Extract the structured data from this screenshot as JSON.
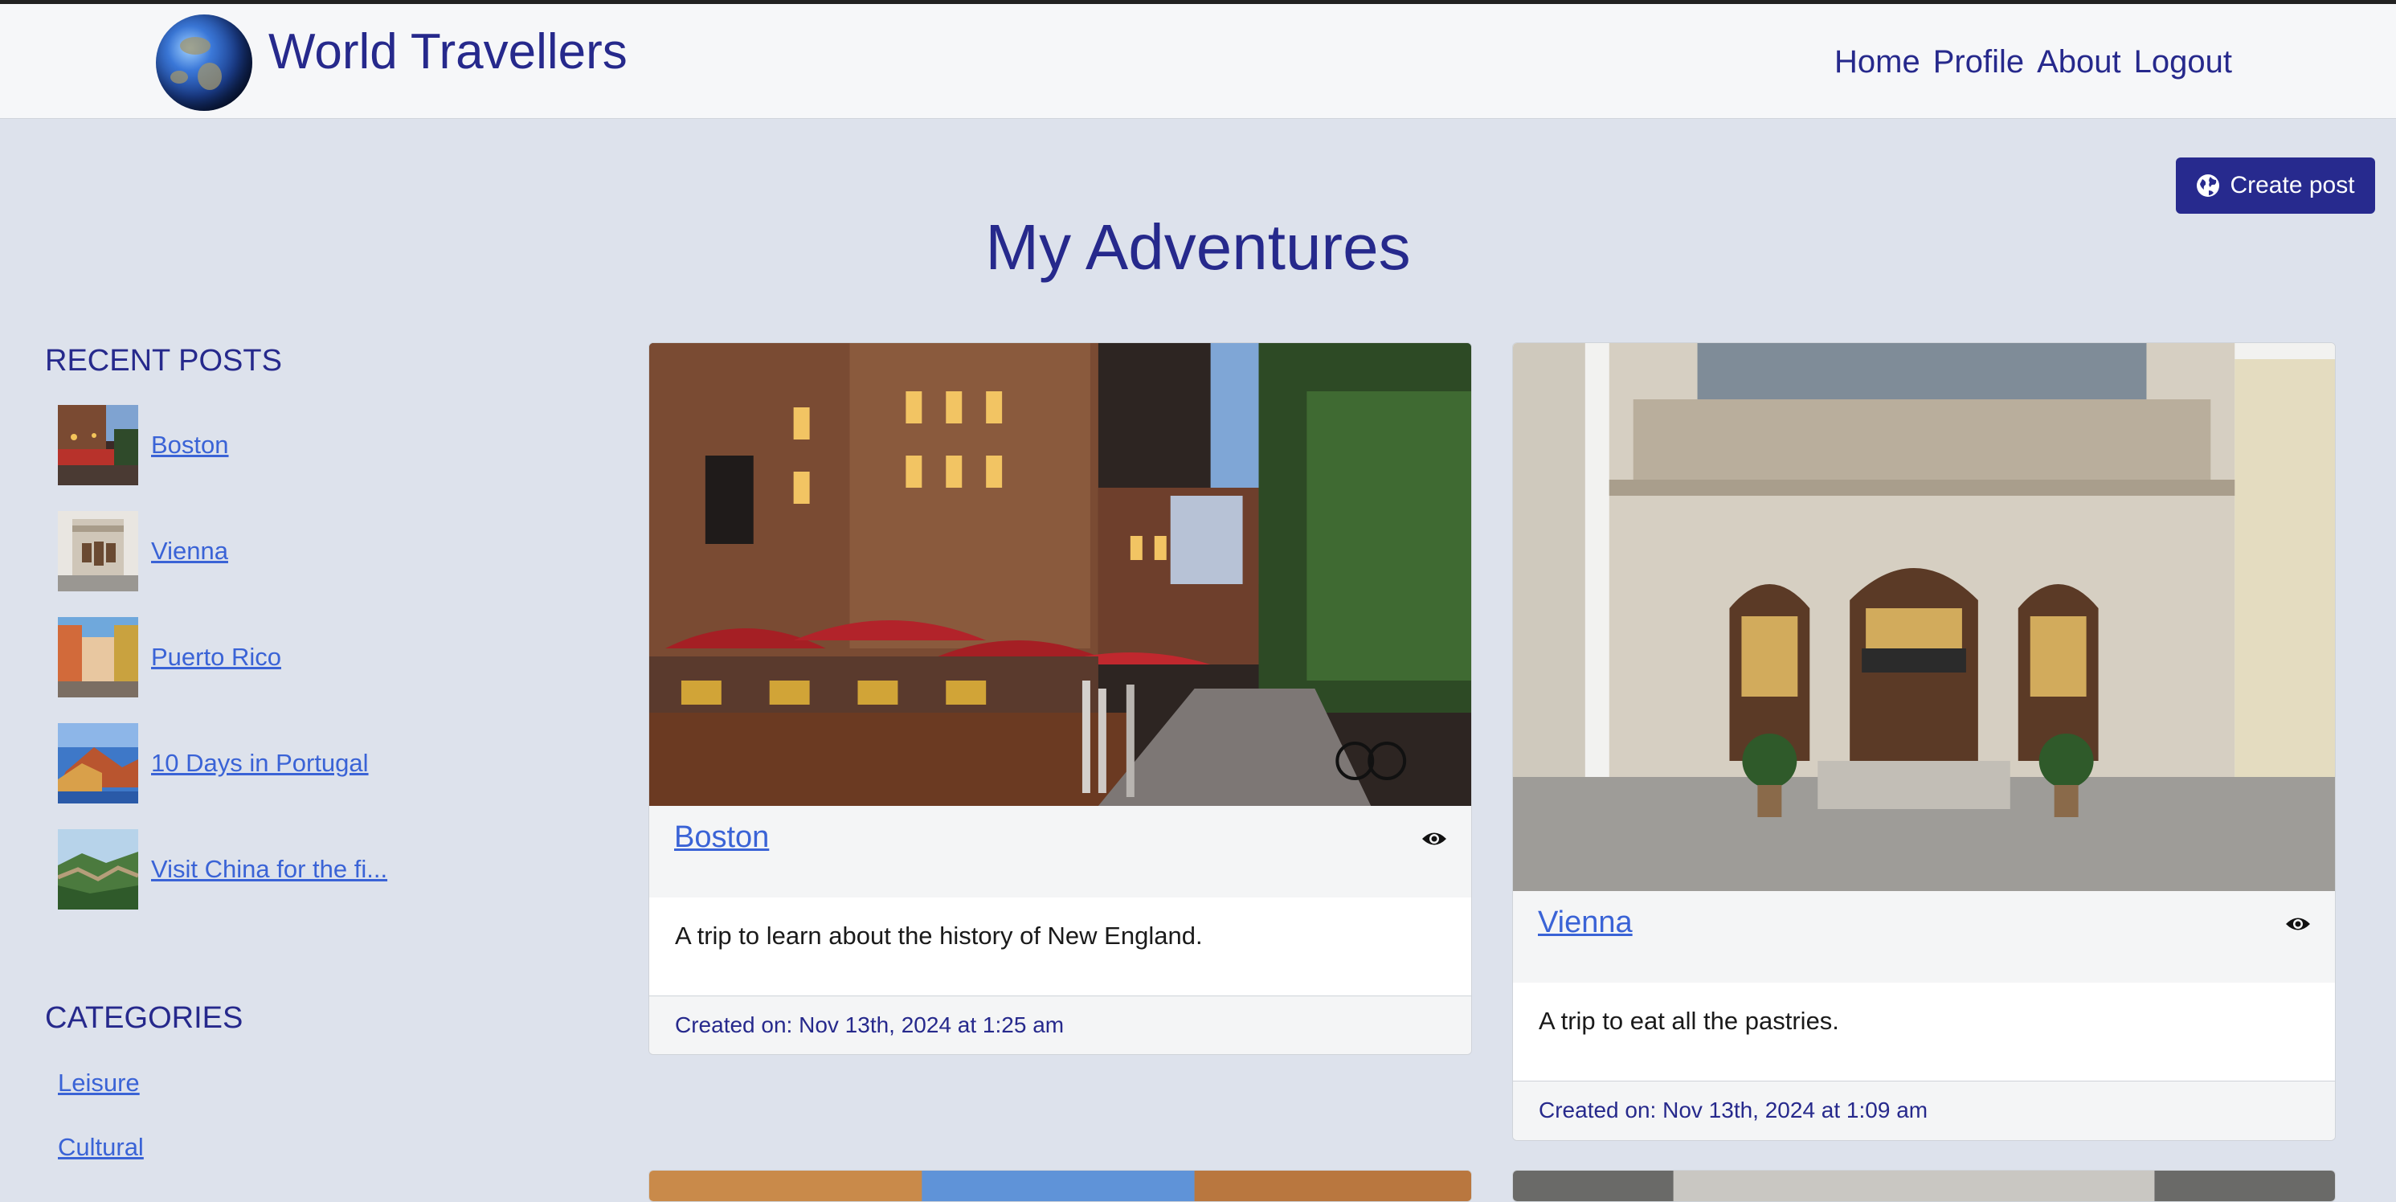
{
  "header": {
    "brand": "World Travellers",
    "nav": [
      "Home",
      "Profile",
      "About",
      "Logout"
    ]
  },
  "create_button": "Create post",
  "page_title": "My Adventures",
  "sidebar": {
    "recent_heading": "RECENT POSTS",
    "recent_posts": [
      "Boston",
      "Vienna",
      "Puerto Rico",
      "10 Days in Portugal",
      "Visit China for the fi..."
    ],
    "categories_heading": "CATEGORIES",
    "categories": [
      "Leisure",
      "Cultural"
    ]
  },
  "posts": [
    {
      "title": "Boston",
      "description": "A trip to learn about the history of New England.",
      "created": "Created on: Nov 13th, 2024 at 1:25 am"
    },
    {
      "title": "Vienna",
      "description": "A trip to eat all the pastries.",
      "created": "Created on: Nov 13th, 2024 at 1:09 am"
    }
  ],
  "colors": {
    "accent": "#26298c",
    "link": "#3a63d6",
    "background": "#dde2ec"
  },
  "icons": {
    "create": "globe-icon",
    "view": "eye-icon"
  }
}
